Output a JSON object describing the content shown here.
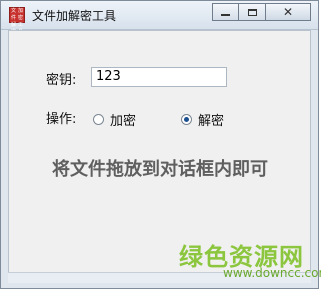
{
  "window": {
    "title": "文件加解密工具",
    "icon_text": [
      "文件",
      "加密",
      "解密",
      "工具"
    ]
  },
  "form": {
    "key_label": "密钥:",
    "key_value": "123",
    "operation_label": "操作:",
    "options": [
      "加密",
      "解密"
    ],
    "selected_option": "解密",
    "drop_hint": "将文件拖放到对话框内即可"
  },
  "watermark": {
    "title": "绿色资源网",
    "url": "www.downcc.com"
  }
}
